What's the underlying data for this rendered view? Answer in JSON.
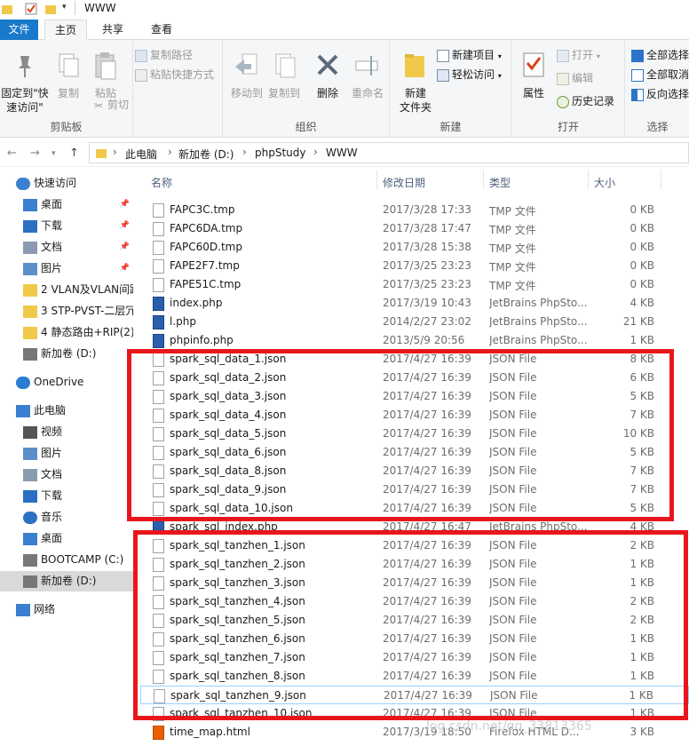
{
  "window": {
    "title": "WWW"
  },
  "tabs": [
    {
      "label": "文件"
    },
    {
      "label": "主页"
    },
    {
      "label": "共享"
    },
    {
      "label": "查看"
    }
  ],
  "ribbon": {
    "clipboard": {
      "group_label": "剪贴板",
      "pin_label_1": "固定到\"快",
      "pin_label_2": "速访问\"",
      "copy": "复制",
      "paste": "粘贴",
      "copy_path": "复制路径",
      "paste_shortcut": "粘贴快捷方式",
      "cut": "剪切"
    },
    "organize": {
      "group_label": "组织",
      "move_to": "移动到",
      "copy_to": "复制到",
      "delete": "删除",
      "rename": "重命名"
    },
    "new": {
      "group_label": "新建",
      "new_folder_1": "新建",
      "new_folder_2": "文件夹",
      "new_item": "新建项目",
      "easy_access": "轻松访问"
    },
    "open": {
      "group_label": "打开",
      "properties": "属性",
      "open": "打开",
      "edit": "编辑",
      "history": "历史记录"
    },
    "select": {
      "group_label": "选择",
      "select_all": "全部选择",
      "select_none": "全部取消",
      "invert": "反向选择"
    }
  },
  "breadcrumb": [
    "此电脑",
    "新加卷 (D:)",
    "phpStudy",
    "WWW"
  ],
  "sidebar": {
    "items": [
      {
        "label": "快速访问",
        "icon": "star-icon",
        "level": 0
      },
      {
        "label": "桌面",
        "icon": "desktop-icon",
        "level": 1,
        "pinned": true
      },
      {
        "label": "下载",
        "icon": "download-icon",
        "level": 1,
        "pinned": true
      },
      {
        "label": "文档",
        "icon": "document-icon",
        "level": 1,
        "pinned": true
      },
      {
        "label": "图片",
        "icon": "picture-icon",
        "level": 1,
        "pinned": true
      },
      {
        "label": "2 VLAN及VLAN间路",
        "icon": "folder-icon",
        "level": 1
      },
      {
        "label": "3 STP-PVST-二层冗",
        "icon": "folder-icon",
        "level": 1
      },
      {
        "label": "4 静态路由+RIP(2)",
        "icon": "folder-icon",
        "level": 1
      },
      {
        "label": "新加卷 (D:)",
        "icon": "drive-icon",
        "level": 1
      },
      {
        "label": "OneDrive",
        "icon": "cloud-icon",
        "level": 0
      },
      {
        "label": "此电脑",
        "icon": "computer-icon",
        "level": 0
      },
      {
        "label": "视频",
        "icon": "video-icon",
        "level": 1
      },
      {
        "label": "图片",
        "icon": "picture-icon",
        "level": 1
      },
      {
        "label": "文档",
        "icon": "document-icon",
        "level": 1
      },
      {
        "label": "下载",
        "icon": "download-icon",
        "level": 1
      },
      {
        "label": "音乐",
        "icon": "music-icon",
        "level": 1
      },
      {
        "label": "桌面",
        "icon": "desktop-icon",
        "level": 1
      },
      {
        "label": "BOOTCAMP (C:)",
        "icon": "drive-icon",
        "level": 1
      },
      {
        "label": "新加卷 (D:)",
        "icon": "drive-icon",
        "level": 1,
        "selected": true
      },
      {
        "label": "网络",
        "icon": "network-icon",
        "level": 0
      }
    ],
    "pin_glyph": "📌"
  },
  "columns": {
    "name": "名称",
    "date": "修改日期",
    "type": "类型",
    "size": "大小"
  },
  "files": [
    {
      "name": "FAPC3C.tmp",
      "date": "2017/3/28 17:33",
      "type": "TMP 文件",
      "size": "0 KB",
      "icon": "tmp"
    },
    {
      "name": "FAPC6DA.tmp",
      "date": "2017/3/28 17:47",
      "type": "TMP 文件",
      "size": "0 KB",
      "icon": "tmp"
    },
    {
      "name": "FAPC60D.tmp",
      "date": "2017/3/28 15:38",
      "type": "TMP 文件",
      "size": "0 KB",
      "icon": "tmp"
    },
    {
      "name": "FAPE2F7.tmp",
      "date": "2017/3/25 23:23",
      "type": "TMP 文件",
      "size": "0 KB",
      "icon": "tmp"
    },
    {
      "name": "FAPE51C.tmp",
      "date": "2017/3/25 23:23",
      "type": "TMP 文件",
      "size": "0 KB",
      "icon": "tmp"
    },
    {
      "name": "index.php",
      "date": "2017/3/19 10:43",
      "type": "JetBrains PhpSto...",
      "size": "4 KB",
      "icon": "php"
    },
    {
      "name": "l.php",
      "date": "2014/2/27 23:02",
      "type": "JetBrains PhpSto...",
      "size": "21 KB",
      "icon": "php"
    },
    {
      "name": "phpinfo.php",
      "date": "2013/5/9 20:56",
      "type": "JetBrains PhpSto...",
      "size": "1 KB",
      "icon": "php"
    },
    {
      "name": "spark_sql_data_1.json",
      "date": "2017/4/27 16:39",
      "type": "JSON File",
      "size": "8 KB",
      "icon": "json"
    },
    {
      "name": "spark_sql_data_2.json",
      "date": "2017/4/27 16:39",
      "type": "JSON File",
      "size": "6 KB",
      "icon": "json"
    },
    {
      "name": "spark_sql_data_3.json",
      "date": "2017/4/27 16:39",
      "type": "JSON File",
      "size": "5 KB",
      "icon": "json"
    },
    {
      "name": "spark_sql_data_4.json",
      "date": "2017/4/27 16:39",
      "type": "JSON File",
      "size": "7 KB",
      "icon": "json"
    },
    {
      "name": "spark_sql_data_5.json",
      "date": "2017/4/27 16:39",
      "type": "JSON File",
      "size": "10 KB",
      "icon": "json"
    },
    {
      "name": "spark_sql_data_6.json",
      "date": "2017/4/27 16:39",
      "type": "JSON File",
      "size": "5 KB",
      "icon": "json"
    },
    {
      "name": "spark_sql_data_8.json",
      "date": "2017/4/27 16:39",
      "type": "JSON File",
      "size": "7 KB",
      "icon": "json"
    },
    {
      "name": "spark_sql_data_9.json",
      "date": "2017/4/27 16:39",
      "type": "JSON File",
      "size": "7 KB",
      "icon": "json"
    },
    {
      "name": "spark_sql_data_10.json",
      "date": "2017/4/27 16:39",
      "type": "JSON File",
      "size": "5 KB",
      "icon": "json"
    },
    {
      "name": "spark_sql_index.php",
      "date": "2017/4/27 16:47",
      "type": "JetBrains PhpSto...",
      "size": "4 KB",
      "icon": "php"
    },
    {
      "name": "spark_sql_tanzhen_1.json",
      "date": "2017/4/27 16:39",
      "type": "JSON File",
      "size": "2 KB",
      "icon": "json"
    },
    {
      "name": "spark_sql_tanzhen_2.json",
      "date": "2017/4/27 16:39",
      "type": "JSON File",
      "size": "1 KB",
      "icon": "json"
    },
    {
      "name": "spark_sql_tanzhen_3.json",
      "date": "2017/4/27 16:39",
      "type": "JSON File",
      "size": "1 KB",
      "icon": "json"
    },
    {
      "name": "spark_sql_tanzhen_4.json",
      "date": "2017/4/27 16:39",
      "type": "JSON File",
      "size": "2 KB",
      "icon": "json"
    },
    {
      "name": "spark_sql_tanzhen_5.json",
      "date": "2017/4/27 16:39",
      "type": "JSON File",
      "size": "2 KB",
      "icon": "json"
    },
    {
      "name": "spark_sql_tanzhen_6.json",
      "date": "2017/4/27 16:39",
      "type": "JSON File",
      "size": "1 KB",
      "icon": "json"
    },
    {
      "name": "spark_sql_tanzhen_7.json",
      "date": "2017/4/27 16:39",
      "type": "JSON File",
      "size": "1 KB",
      "icon": "json"
    },
    {
      "name": "spark_sql_tanzhen_8.json",
      "date": "2017/4/27 16:39",
      "type": "JSON File",
      "size": "1 KB",
      "icon": "json"
    },
    {
      "name": "spark_sql_tanzhen_9.json",
      "date": "2017/4/27 16:39",
      "type": "JSON File",
      "size": "1 KB",
      "icon": "json",
      "focused": true
    },
    {
      "name": "spark_sql_tanzhen_10.json",
      "date": "2017/4/27 16:39",
      "type": "JSON File",
      "size": "1 KB",
      "icon": "json"
    },
    {
      "name": "time_map.html",
      "date": "2017/3/19 18:50",
      "type": "Firefox HTML D...",
      "size": "3 KB",
      "icon": "html"
    }
  ],
  "watermark": "log.csdn.net/qq_33813365",
  "colors": {
    "accent": "#1979ca",
    "highlight": "#e8161c",
    "selected": "#d9d9d9"
  }
}
